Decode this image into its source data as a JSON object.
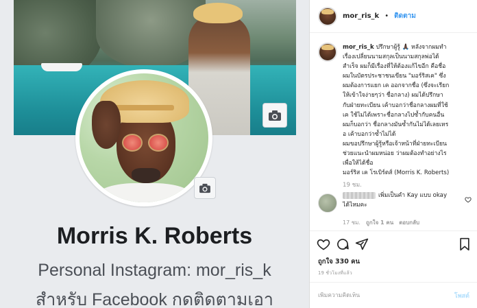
{
  "facebook_profile": {
    "name": "Morris K. Roberts",
    "bio_line_1": "Personal Instagram: mor_ris_k",
    "bio_line_2": "สำหรับ Facebook กดติดตามเอา"
  },
  "instagram_post": {
    "header": {
      "username": "mor_ris_k",
      "separator": "•",
      "follow_label": "ติดตาม"
    },
    "caption": {
      "username": "mor_ris_k",
      "text_lines": [
        "ปรึกษาผู้รู้ 🙏🏿 หลังจากผมทำ",
        "เรื่องเปลี่ยนนามสกุลเป็นนามสกุลพ่อได้",
        "สำเร็จ ผมก็มีเรื่องที่ให้ต้องแก้ไขอีก คือชื่อ",
        "ผมในบัตรประชาชนเขียน \"มอร์ริสเค\" ซึ่ง",
        "ผมต้องการแยก เค ออกจากชื่อ (ซึ่งจะเรียก",
        "ให้เข้าใจง่ายๆว่า ชื่อกลาง) ผมได้ปรึกษา",
        "กับฝ่ายทะเบียน เค้าบอกว่าชื่อกลางผมที่ใช้",
        "เค ใช้ไม่ได้เพราะชื่อกลางไปซ้ำกับคนอื่น",
        "ผมก็บอกว่า ชื่อกลางมันซ้ำกันไม่ได้เลยเหร",
        "อ เค้าบอกว่าซ้ำไม่ได้",
        "ผมขอปรึกษาผู้รู้หรือเจ้าหน้าที่ฝ่ายทะเบียน",
        "ช่วยแนะนำผมหน่อย ว่าผมต้องทำอย่างไร",
        "เพื่อให้ได้ชื่อ",
        "มอร์ริส เค โรเบิร์ตส์ (Morris K. Roberts)"
      ],
      "time": "19 ชม."
    },
    "comment": {
      "text_line_1": "เพิ่มเป็นคำ Kay แบบ okay",
      "text_line_2": "ได้ไหมคะ",
      "time": "17 ชม.",
      "likes": "ถูกใจ 1 คน",
      "reply_label": "ตอบกลับ"
    },
    "likes": "ถูกใจ 330 คน",
    "post_time": "19 ชั่วโมงที่แล้ว",
    "comment_box": {
      "placeholder": "เพิ่มความคิดเห็น",
      "post_label": "โพสต์"
    }
  },
  "icons": {
    "cover_camera": "camera-icon",
    "avatar_camera": "camera-icon",
    "like": "heart-icon",
    "comment": "comment-icon",
    "share": "share-icon",
    "save": "bookmark-icon",
    "comment_like": "heart-icon"
  },
  "colors": {
    "ig_link": "#3897f0",
    "ig_secondary_text": "#999999",
    "fb_background": "#e9ebee",
    "fb_name": "#1c1e21"
  }
}
